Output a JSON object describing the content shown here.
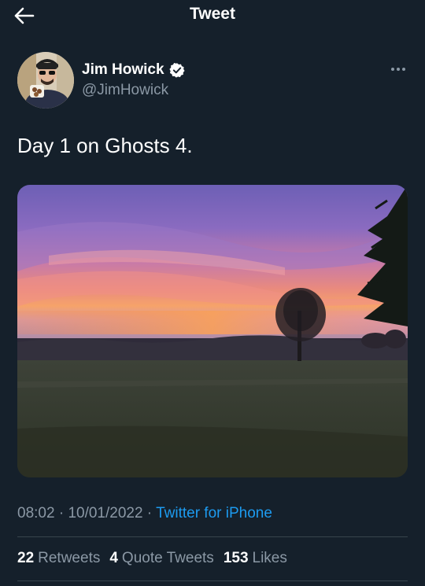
{
  "header": {
    "title": "Tweet",
    "back_icon": "arrow-left-icon"
  },
  "author": {
    "display_name": "Jim Howick",
    "handle": "@JimHowick",
    "verified_icon": "verified-badge-icon",
    "more_icon": "more-horizontal-icon"
  },
  "tweet": {
    "text": "Day 1 on Ghosts 4.",
    "media_description": "sunrise-field-photo"
  },
  "meta": {
    "time": "08:02",
    "separator1": " · ",
    "date": "10/01/2022",
    "separator2": " · ",
    "source": "Twitter for iPhone"
  },
  "stats": {
    "retweets_count": "22",
    "retweets_label": "Retweets",
    "quotes_count": "4",
    "quotes_label": "Quote Tweets",
    "likes_count": "153",
    "likes_label": "Likes"
  },
  "colors": {
    "background": "#15202b",
    "secondary_text": "#8b98a5",
    "link": "#1d9bf0",
    "divider": "#38444d"
  }
}
